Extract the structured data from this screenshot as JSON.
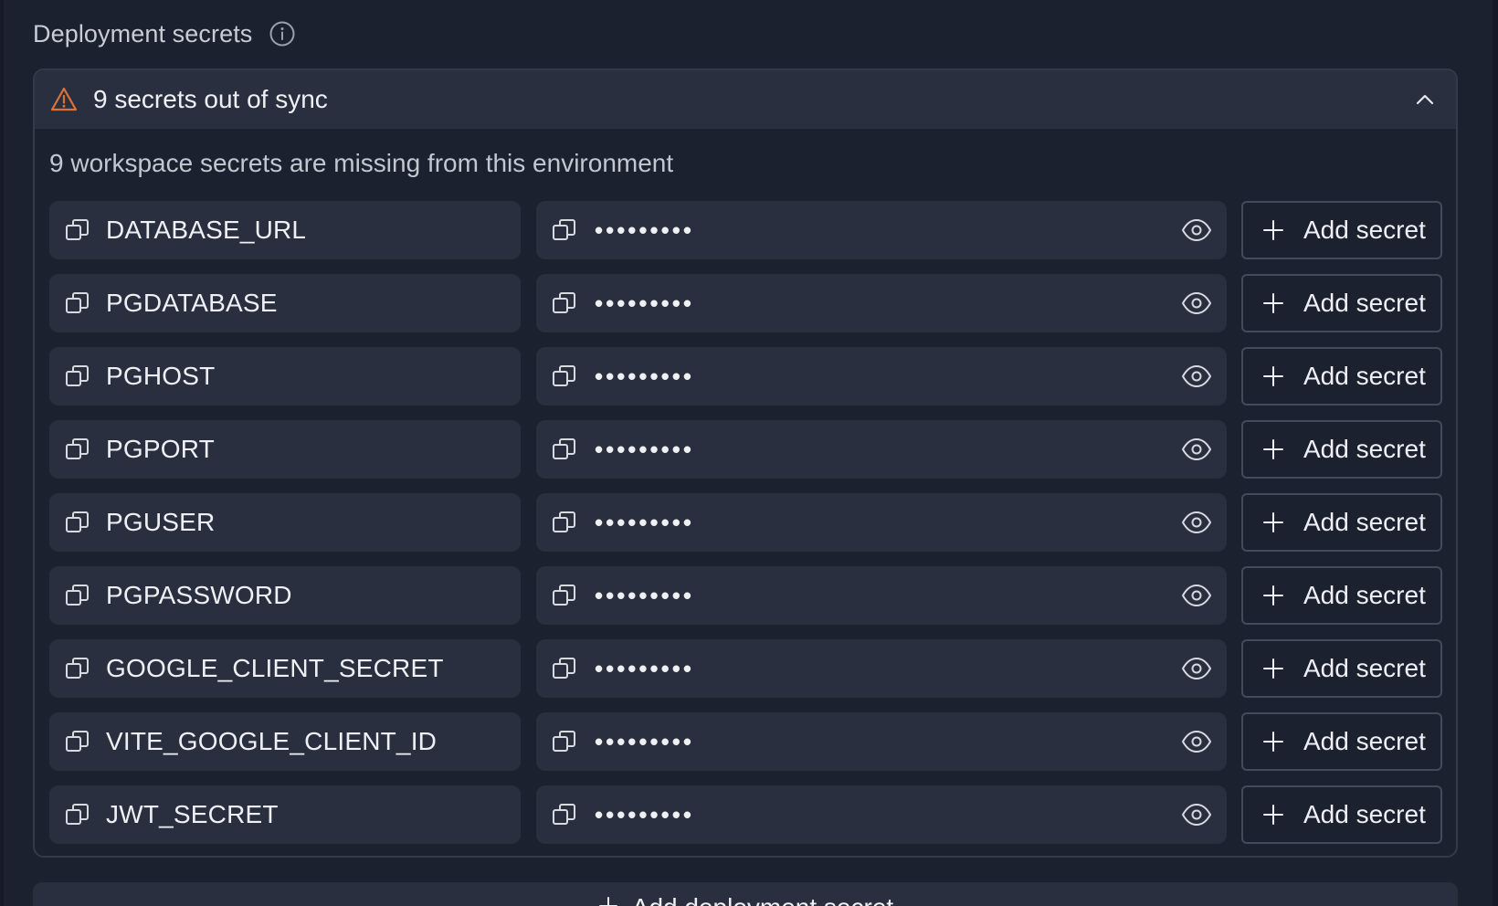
{
  "section": {
    "title": "Deployment secrets",
    "info_icon": "info-icon"
  },
  "sync_panel": {
    "warning_icon": "warning-triangle-icon",
    "title": "9 secrets out of sync",
    "collapse_icon": "chevron-up-icon",
    "subtitle": "9 workspace secrets are missing from this environment"
  },
  "secrets": [
    {
      "key": "DATABASE_URL",
      "value_masked": "•••••••••",
      "action_label": "Add secret"
    },
    {
      "key": "PGDATABASE",
      "value_masked": "•••••••••",
      "action_label": "Add secret"
    },
    {
      "key": "PGHOST",
      "value_masked": "•••••••••",
      "action_label": "Add secret"
    },
    {
      "key": "PGPORT",
      "value_masked": "•••••••••",
      "action_label": "Add secret"
    },
    {
      "key": "PGUSER",
      "value_masked": "•••••••••",
      "action_label": "Add secret"
    },
    {
      "key": "PGPASSWORD",
      "value_masked": "•••••••••",
      "action_label": "Add secret"
    },
    {
      "key": "GOOGLE_CLIENT_SECRET",
      "value_masked": "•••••••••",
      "action_label": "Add secret"
    },
    {
      "key": "VITE_GOOGLE_CLIENT_ID",
      "value_masked": "•••••••••",
      "action_label": "Add secret"
    },
    {
      "key": "JWT_SECRET",
      "value_masked": "•••••••••",
      "action_label": "Add secret"
    }
  ],
  "icons": {
    "copy": "copy-icon",
    "reveal": "eye-icon",
    "add": "plus-icon"
  },
  "bottom_action": {
    "label": "Add deployment secret"
  },
  "colors": {
    "background": "#1c2130",
    "surface": "#2a2f40",
    "warning": "#d9733a",
    "text": "#eef0f4"
  }
}
